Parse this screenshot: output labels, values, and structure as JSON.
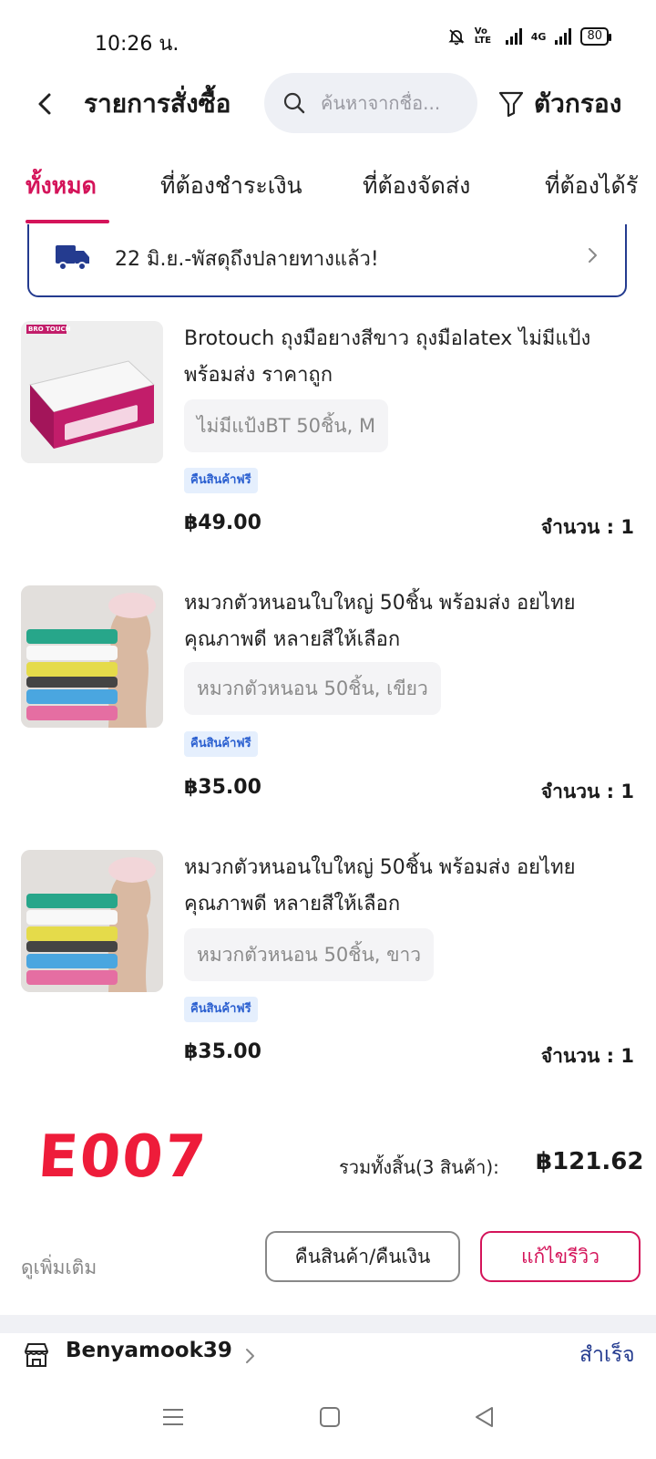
{
  "status_bar": {
    "time": "10:26 น.",
    "volte": "Vo LTE",
    "network": "4G",
    "battery": "80"
  },
  "header": {
    "title": "รายการสั่งซื้อ",
    "search_placeholder": "ค้นหาจากชื่อ...",
    "filter_label": "ตัวกรอง"
  },
  "tabs": [
    {
      "label": "ทั้งหมด",
      "active": true
    },
    {
      "label": "ที่ต้องชำระเงิน",
      "active": false
    },
    {
      "label": "ที่ต้องจัดส่ง",
      "active": false
    },
    {
      "label": "ที่ต้องได้รั",
      "active": false
    }
  ],
  "banner": {
    "text": "22 มิ.ย.-พัสดุถึงปลายทางแล้ว!"
  },
  "items": [
    {
      "name": "Brotouch ถุงมือยางสีขาว ถุงมือlatex ไม่มีแป้ง พร้อมส่ง ราคาถูก",
      "variant": "ไม่มีแป้งBT 50ชิ้น, M",
      "tag": "คืนสินค้าฟรี",
      "price": "฿49.00",
      "quantity": "จำนวน : 1",
      "thumb_brand": "BRO TOUCH"
    },
    {
      "name": "หมวกตัวหนอนใบใหญ่ 50ชิ้น พร้อมส่ง อยไทย คุณภาพดี หลายสีให้เลือก",
      "variant": "หมวกตัวหนอน 50ชิ้น, เขียว",
      "tag": "คืนสินค้าฟรี",
      "price": "฿35.00",
      "quantity": "จำนวน : 1"
    },
    {
      "name": "หมวกตัวหนอนใบใหญ่ 50ชิ้น พร้อมส่ง อยไทย คุณภาพดี หลายสีให้เลือก",
      "variant": "หมวกตัวหนอน 50ชิ้น, ขาว",
      "tag": "คืนสินค้าฟรี",
      "price": "฿35.00",
      "quantity": "จำนวน : 1"
    }
  ],
  "stamp": "E007",
  "total": {
    "label": "รวมทั้งสิ้น(3 สินค้า):",
    "value": "฿121.62"
  },
  "actions": {
    "more": "ดูเพิ่มเติม",
    "return_refund": "คืนสินค้า/คืนเงิน",
    "edit_review": "แก้ไขรีวิว"
  },
  "shop": {
    "name": "Benyamook39",
    "status": "สำเร็จ"
  },
  "colors": {
    "accent": "#d4145a",
    "navy": "#243b8f",
    "tag_bg": "#e5effd",
    "tag_text": "#2a5fd0",
    "stamp": "#ee1c3a"
  }
}
